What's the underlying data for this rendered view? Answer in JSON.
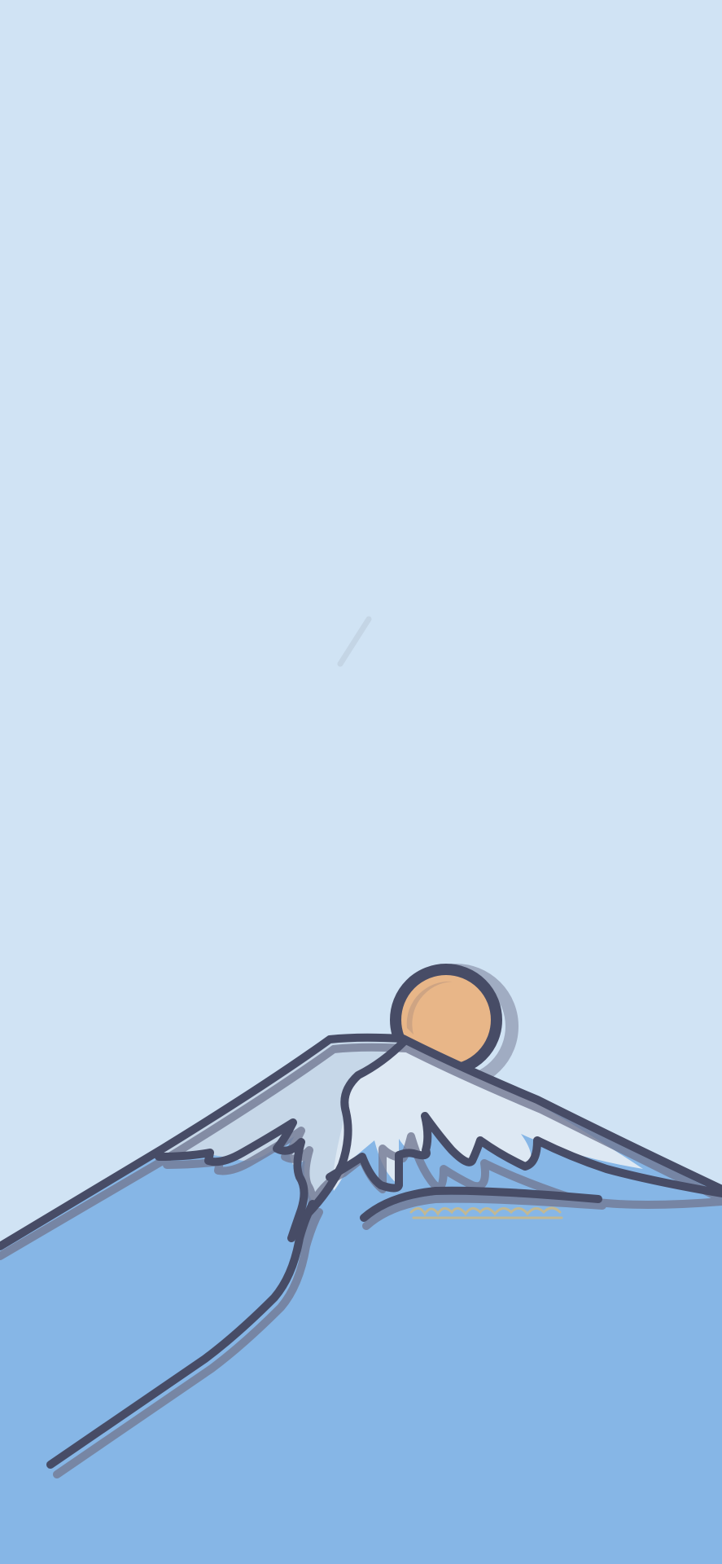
{
  "scene": {
    "subject": "mountain-with-sun-illustration",
    "colors": {
      "sky": "#d0e3f4",
      "mountain_body": "#86b6e6",
      "snow_cap_left": "#c6d7e8",
      "snow_cap_right": "#dde8f3",
      "sun": "#e8b688",
      "outline": "#474c66",
      "shadow": "#737a94",
      "signature": "#c9b98a"
    }
  }
}
